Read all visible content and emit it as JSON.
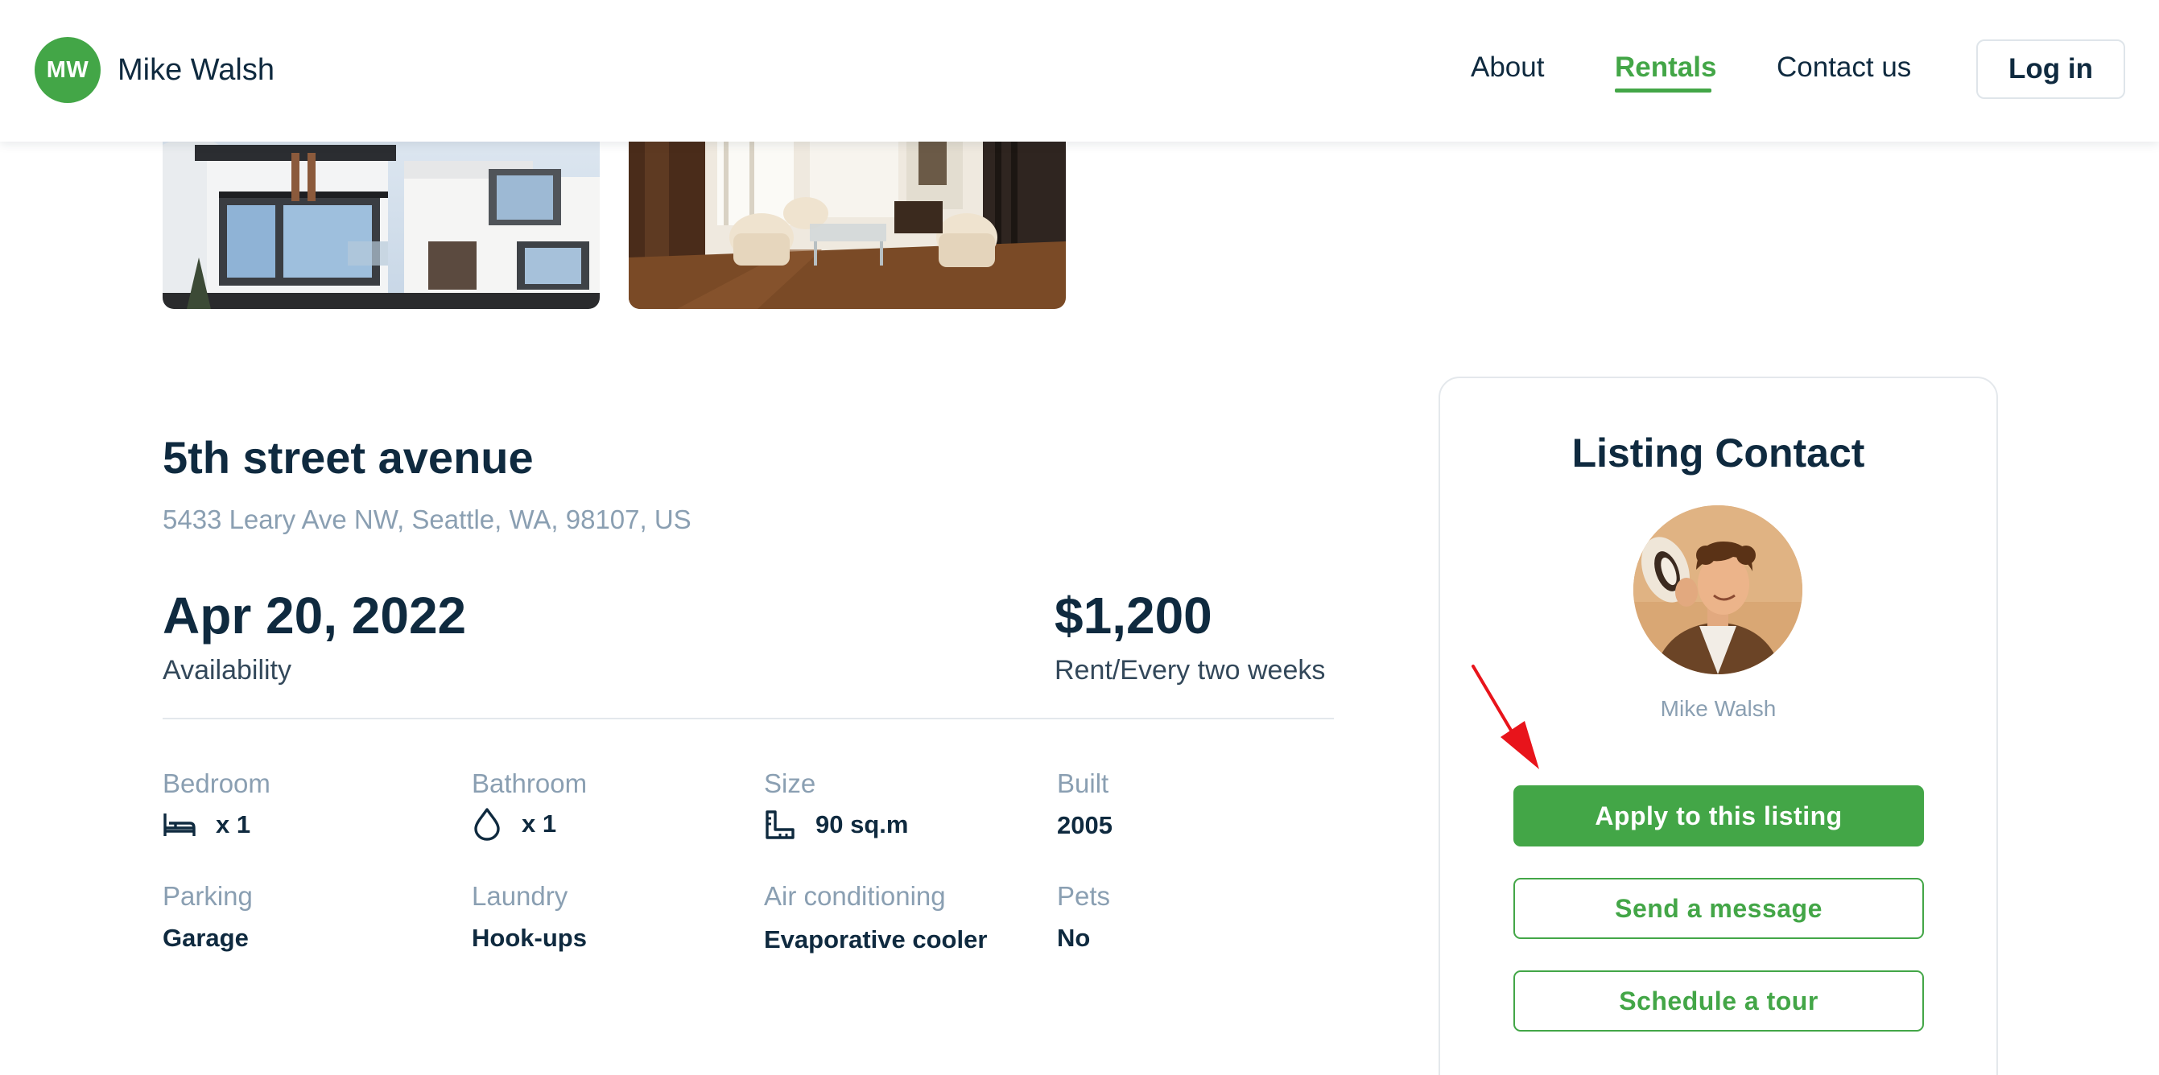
{
  "header": {
    "brand_initials": "MW",
    "brand_name": "Mike Walsh",
    "nav": [
      {
        "label": "About",
        "active": false
      },
      {
        "label": "Rentals",
        "active": true
      },
      {
        "label": "Contact us",
        "active": false
      }
    ],
    "login_label": "Log in"
  },
  "listing": {
    "title": "5th street avenue",
    "address": "5433 Leary Ave NW, Seattle, WA, 98107, US",
    "availability_date": "Apr 20, 2022",
    "availability_caption": "Availability",
    "price": "$1,200",
    "price_caption": "Rent/Every two weeks",
    "specs": [
      {
        "label": "Bedroom",
        "value": "x 1",
        "icon": "bed-icon"
      },
      {
        "label": "Bathroom",
        "value": "x 1",
        "icon": "water-drop-icon"
      },
      {
        "label": "Size",
        "value": "90 sq.m",
        "icon": "ruler-icon"
      },
      {
        "label": "Built",
        "value": "2005"
      },
      {
        "label": "Parking",
        "value": "Garage"
      },
      {
        "label": "Laundry",
        "value": "Hook-ups"
      },
      {
        "label": "Air conditioning",
        "value": "Evaporative cooler"
      },
      {
        "label": "Pets",
        "value": "No"
      }
    ]
  },
  "contact": {
    "title": "Listing Contact",
    "name": "Mike Walsh",
    "apply_label": "Apply to this listing",
    "message_label": "Send a message",
    "tour_label": "Schedule a tour"
  },
  "colors": {
    "accent": "#43a647",
    "text_dark": "#0f2a3f",
    "text_muted": "#8a9fb2",
    "annotation_arrow": "#e8141b"
  }
}
